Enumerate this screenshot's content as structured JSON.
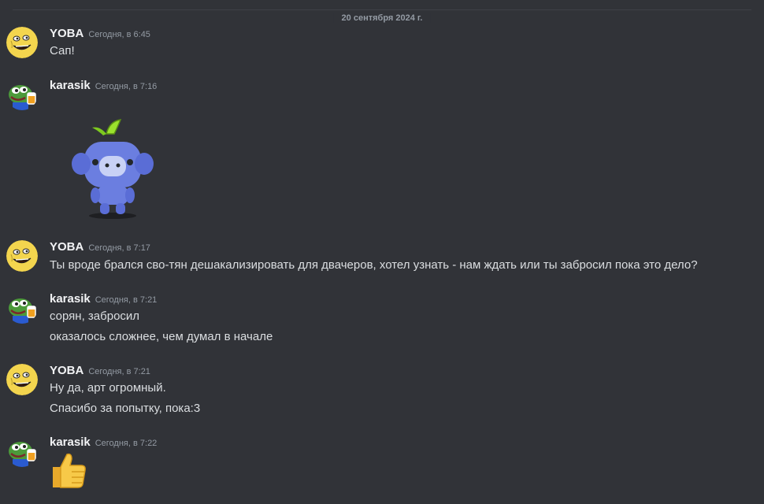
{
  "divider": {
    "date": "20 сентября 2024 г."
  },
  "messages": [
    {
      "author": "YOBA",
      "time": "Сегодня, в 6:45",
      "lines": [
        "Сап!"
      ]
    },
    {
      "author": "karasik",
      "time": "Сегодня, в 7:16",
      "lines": []
    },
    {
      "author": "YOBA",
      "time": "Сегодня, в 7:17",
      "lines": [
        "Ты вроде брался сво-тян дешакализировать для двачеров, хотел узнать - нам ждать или ты забросил пока это дело?"
      ]
    },
    {
      "author": "karasik",
      "time": "Сегодня, в 7:21",
      "lines": [
        "сорян, забросил",
        "оказалось сложнее, чем думал в начале"
      ]
    },
    {
      "author": "YOBA",
      "time": "Сегодня, в 7:21",
      "lines": [
        "Ну да, арт огромный.",
        "Спасибо за попытку, пока:3"
      ]
    },
    {
      "author": "karasik",
      "time": "Сегодня, в 7:22",
      "lines": []
    }
  ],
  "icons": {
    "yoba_avatar": "yoba-face-icon",
    "karasik_avatar": "pepe-frog-icon",
    "sticker": "wumpus-sticker-icon",
    "emoji": "thumbs-up-icon"
  },
  "colors": {
    "background": "#313338",
    "author": "#f2f3f5",
    "text": "#dbdee1",
    "muted": "#949ba4"
  }
}
